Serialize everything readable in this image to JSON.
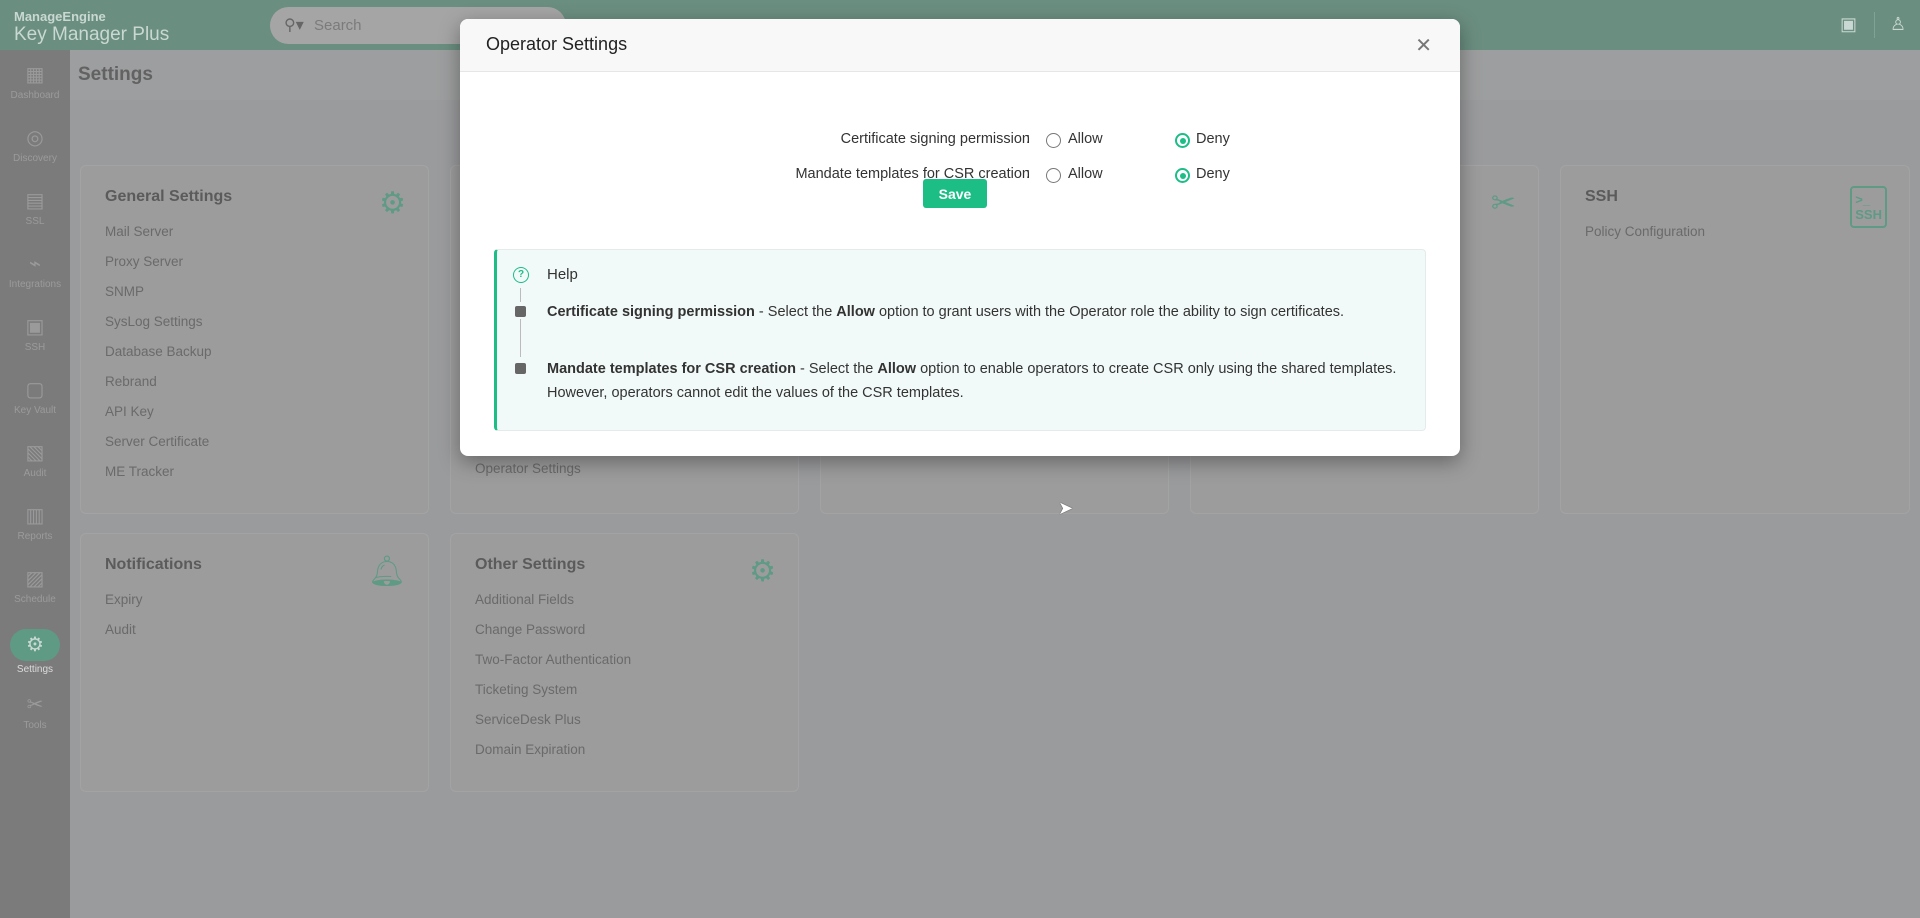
{
  "header": {
    "brand_top": "ManageEngine",
    "brand_product": "Key Manager Plus",
    "search_placeholder": "Search"
  },
  "sidebar": {
    "items": [
      {
        "label": "Dashboard",
        "icon": "dashboard-icon",
        "glyph": "▦"
      },
      {
        "label": "Discovery",
        "icon": "compass-icon",
        "glyph": "◎"
      },
      {
        "label": "SSL",
        "icon": "certificate-icon",
        "glyph": "▤"
      },
      {
        "label": "Integrations",
        "icon": "plug-icon",
        "glyph": "⌁"
      },
      {
        "label": "SSH",
        "icon": "terminal-icon",
        "glyph": "▣"
      },
      {
        "label": "Key Vault",
        "icon": "vault-icon",
        "glyph": "▢"
      },
      {
        "label": "Audit",
        "icon": "audit-icon",
        "glyph": "▧"
      },
      {
        "label": "Reports",
        "icon": "reports-icon",
        "glyph": "▥"
      },
      {
        "label": "Schedule",
        "icon": "calendar-icon",
        "glyph": "▨"
      },
      {
        "label": "Settings",
        "icon": "gear-icon",
        "glyph": "⚙",
        "active": true
      },
      {
        "label": "Tools",
        "icon": "tools-icon",
        "glyph": "✂"
      }
    ]
  },
  "page": {
    "title": "Settings"
  },
  "cards": {
    "general": {
      "title": "General Settings",
      "items": [
        "Mail Server",
        "Proxy Server",
        "SNMP",
        "SysLog Settings",
        "Database Backup",
        "Rebrand",
        "API Key",
        "Server Certificate",
        "ME Tracker"
      ]
    },
    "operator_hidden": {
      "items": [
        "Operator Settings"
      ]
    },
    "ssh": {
      "title": "SSH",
      "items": [
        "Policy Configuration"
      ]
    },
    "notifications": {
      "title": "Notifications",
      "items": [
        "Expiry",
        "Audit"
      ]
    },
    "other": {
      "title": "Other Settings",
      "items": [
        "Additional Fields",
        "Change Password",
        "Two-Factor Authentication",
        "Ticketing System",
        "ServiceDesk Plus",
        "Domain Expiration"
      ]
    }
  },
  "modal": {
    "title": "Operator Settings",
    "rows": [
      {
        "label": "Certificate signing permission",
        "colon": ":",
        "allow": "Allow",
        "deny": "Deny",
        "selected": "Deny"
      },
      {
        "label": "Mandate templates for CSR creation",
        "colon": ":",
        "allow": "Allow",
        "deny": "Deny",
        "selected": "Deny"
      }
    ],
    "save_label": "Save",
    "help": {
      "title": "Help",
      "items": [
        {
          "term": "Certificate signing permission",
          "pre": " - Select the ",
          "bold": "Allow",
          "post": " option to grant users with the Operator role the ability to sign certificates."
        },
        {
          "term": "Mandate templates for CSR creation",
          "pre": " - Select the ",
          "bold": "Allow",
          "post": " option to enable operators to create CSR only using the shared templates. However, operators cannot edit the values of the CSR templates."
        }
      ]
    }
  },
  "colors": {
    "accent": "#1dbd86"
  }
}
